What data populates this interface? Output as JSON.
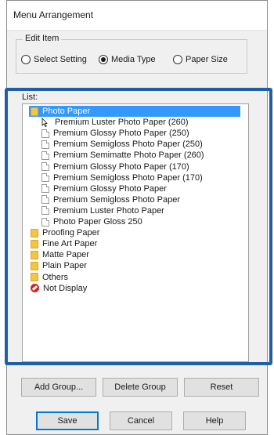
{
  "window": {
    "title": "Menu Arrangement"
  },
  "edit_item": {
    "label": "Edit Item",
    "options": [
      {
        "label": "Select Setting",
        "checked": false
      },
      {
        "label": "Media Type",
        "checked": true
      },
      {
        "label": "Paper Size",
        "checked": false
      }
    ]
  },
  "list": {
    "label": "List:",
    "items": [
      {
        "label": "Photo Paper",
        "icon": "folder-icon",
        "level": 0,
        "selected": true
      },
      {
        "label": "Premium Luster Photo Paper (260)",
        "icon": "doc-icon",
        "level": 1,
        "cursor": true
      },
      {
        "label": "Premium Glossy Photo Paper (250)",
        "icon": "doc-icon",
        "level": 1
      },
      {
        "label": "Premium Semigloss Photo Paper (250)",
        "icon": "doc-icon",
        "level": 1
      },
      {
        "label": "Premium Semimatte Photo Paper (260)",
        "icon": "doc-icon",
        "level": 1
      },
      {
        "label": "Premium Glossy Photo Paper (170)",
        "icon": "doc-icon",
        "level": 1
      },
      {
        "label": "Premium Semigloss Photo Paper (170)",
        "icon": "doc-icon",
        "level": 1
      },
      {
        "label": "Premium Glossy Photo Paper",
        "icon": "doc-icon",
        "level": 1
      },
      {
        "label": "Premium Semigloss Photo Paper",
        "icon": "doc-icon",
        "level": 1
      },
      {
        "label": "Premium Luster Photo Paper",
        "icon": "doc-icon",
        "level": 1
      },
      {
        "label": "Photo Paper Gloss 250",
        "icon": "doc-icon",
        "level": 1
      },
      {
        "label": "Proofing Paper",
        "icon": "folder-icon",
        "level": 0
      },
      {
        "label": "Fine Art Paper",
        "icon": "folder-icon",
        "level": 0
      },
      {
        "label": "Matte Paper",
        "icon": "folder-icon",
        "level": 0
      },
      {
        "label": "Plain Paper",
        "icon": "folder-icon",
        "level": 0
      },
      {
        "label": "Others",
        "icon": "folder-icon",
        "level": 0
      },
      {
        "label": "Not Display",
        "icon": "not-display-icon",
        "level": 0
      }
    ]
  },
  "buttons": {
    "add_group": "Add Group...",
    "delete_group": "Delete Group",
    "reset": "Reset",
    "save": "Save",
    "cancel": "Cancel",
    "help": "Help"
  },
  "colors": {
    "highlight_frame": "#1f5fa8",
    "selection": "#3399ff",
    "folder": "#f4c542",
    "not_display": "#d42020"
  }
}
